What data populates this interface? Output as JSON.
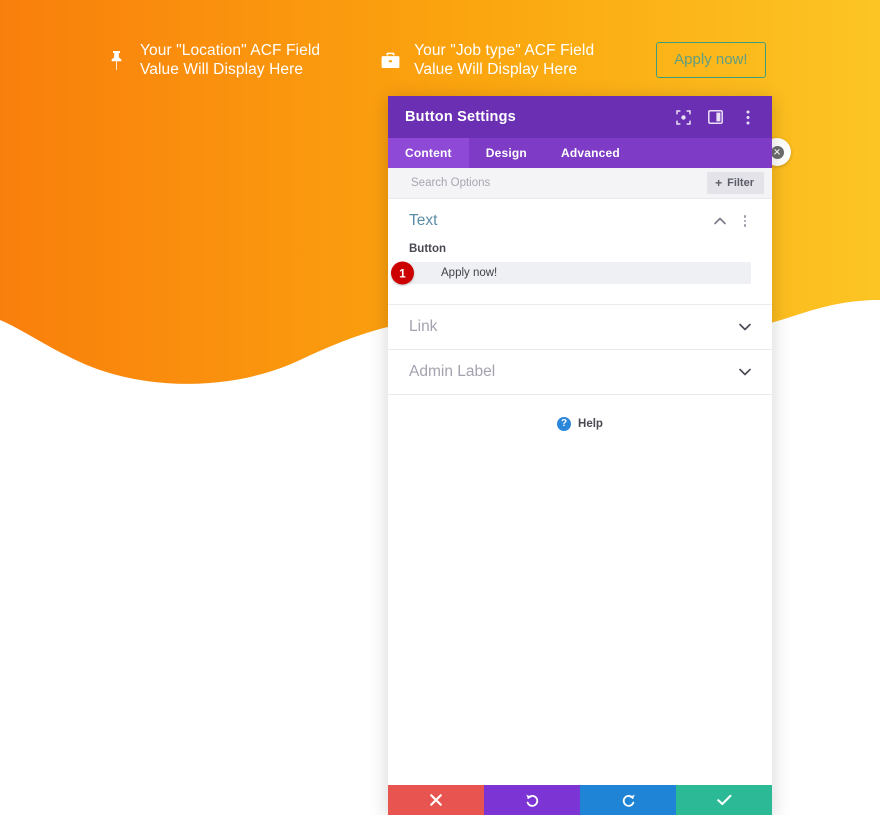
{
  "theme": {
    "gradient_from": "#f97f0c",
    "gradient_to": "#fcc524",
    "modal_titlebar": "#6b2fb4",
    "modal_tabbar": "#7e3cc6",
    "modal_tab_active": "#8e4ad6",
    "badge_red": "#cc0000",
    "footer_cancel": "#e8544f",
    "footer_undo": "#7c35d4",
    "footer_redo": "#1f84d6",
    "footer_save": "#2cb996",
    "section_open_title": "#5b8ca8",
    "help_blue": "#2b87da"
  },
  "hero": {
    "location": {
      "icon": "map-pin-icon",
      "text": "Your \"Location\" ACF Field\nValue Will Display Here"
    },
    "job_type": {
      "icon": "briefcase-icon",
      "text": "Your \"Job type\" ACF Field\nValue Will Display Here"
    },
    "apply_button_label": "Apply now!"
  },
  "module_close_badge": {
    "icon": "close-circle-icon"
  },
  "modal": {
    "title": "Button Settings",
    "titlebar_icons": [
      {
        "name": "expand-icon"
      },
      {
        "name": "layout-panel-icon"
      },
      {
        "name": "kebab-menu-icon"
      }
    ],
    "tabs": [
      {
        "label": "Content",
        "active": true
      },
      {
        "label": "Design",
        "active": false
      },
      {
        "label": "Advanced",
        "active": false
      }
    ],
    "search": {
      "placeholder": "Search Options",
      "value": ""
    },
    "filter_button_label": "Filter",
    "sections": [
      {
        "title": "Text",
        "open": true,
        "field_label": "Button",
        "field_value": "Apply now!",
        "step_badge": "1"
      },
      {
        "title": "Link",
        "open": false
      },
      {
        "title": "Admin Label",
        "open": false
      }
    ],
    "help_label": "Help",
    "footer_buttons": [
      {
        "name": "cancel",
        "icon": "close-icon"
      },
      {
        "name": "undo",
        "icon": "undo-icon"
      },
      {
        "name": "redo",
        "icon": "redo-icon"
      },
      {
        "name": "save",
        "icon": "check-icon"
      }
    ]
  }
}
